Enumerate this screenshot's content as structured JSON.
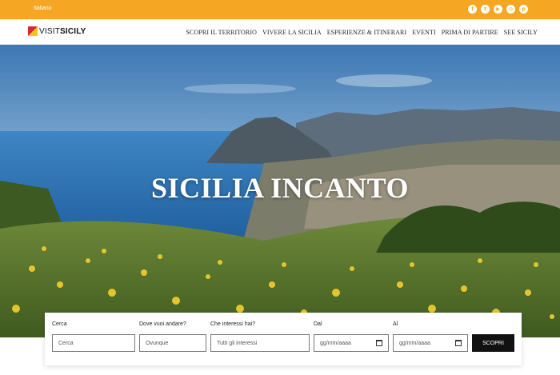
{
  "topbar": {
    "language": "Italiano",
    "social": [
      {
        "icon": "facebook-icon",
        "glyph": "f"
      },
      {
        "icon": "twitter-icon",
        "glyph": "t"
      },
      {
        "icon": "youtube-icon",
        "glyph": "▶"
      },
      {
        "icon": "instagram-icon",
        "glyph": "◎"
      },
      {
        "icon": "pinterest-icon",
        "glyph": "p"
      }
    ],
    "color": "#f5a623"
  },
  "logo": {
    "light": "VISIT",
    "bold": "SICILY"
  },
  "nav": {
    "items": [
      "SCOPRI IL TERRITORIO",
      "VIVERE LA SICILIA",
      "ESPERIENZE & ITINERARI",
      "EVENTI",
      "PRIMA DI PARTIRE",
      "SEE SICILY"
    ]
  },
  "hero": {
    "title": "SICILIA INCANTO"
  },
  "search": {
    "cerca_label": "Cerca",
    "cerca_placeholder": "Cerca",
    "dove_label": "Dove vuoi andare?",
    "dove_value": "Ovunque",
    "interessi_label": "Che interessi hai?",
    "interessi_value": "Tutti gli interessi",
    "dal_label": "Dal",
    "dal_placeholder": "gg/mm/aaaa",
    "al_label": "Al",
    "al_placeholder": "gg/mm/aaaa",
    "button_label": "SCOPRI"
  }
}
